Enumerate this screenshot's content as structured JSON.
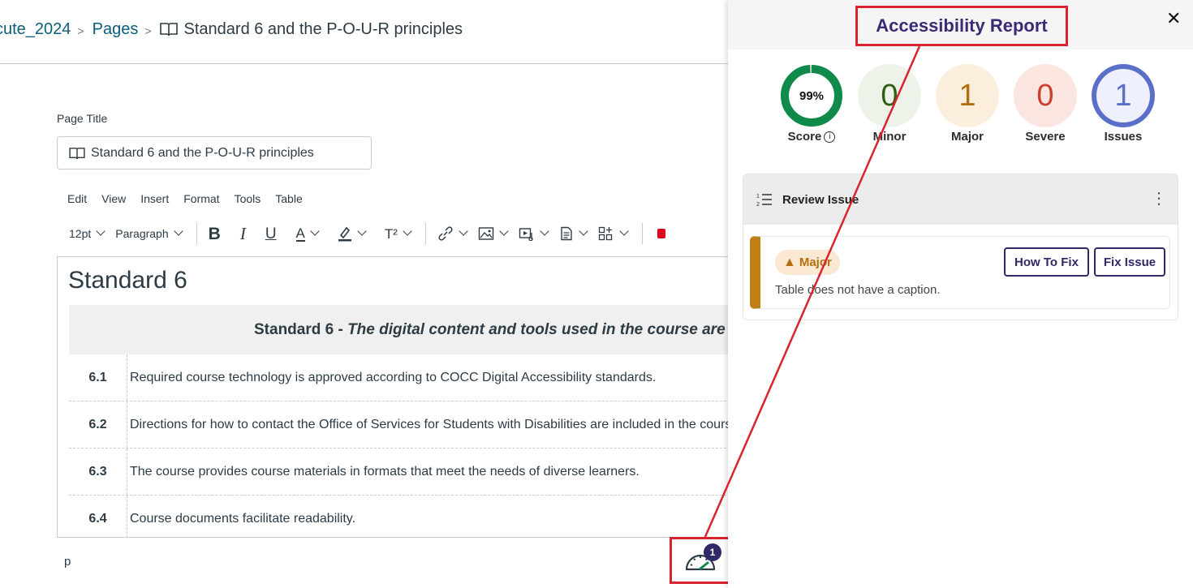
{
  "breadcrumb": {
    "course": "cute_2024",
    "section": "Pages",
    "current": "Standard 6 and the P-O-U-R principles"
  },
  "page_title": {
    "label": "Page Title",
    "value": "Standard 6 and the P-O-U-R principles"
  },
  "menubar": [
    "Edit",
    "View",
    "Insert",
    "Format",
    "Tools",
    "Table"
  ],
  "toolbar": {
    "font_size": "12pt",
    "block_format": "Paragraph",
    "superscript_label": "T²"
  },
  "editor": {
    "heading": "Standard 6",
    "table_header_bold": "Standard 6 - ",
    "table_header_italic": "The digital content and tools used in the course are accessible",
    "rows": [
      {
        "num": "6.1",
        "text": "Required course technology is approved according to COCC Digital Accessibility standards."
      },
      {
        "num": "6.2",
        "text": "Directions for how to contact the Office of Services for Students with Disabilities are included in the course."
      },
      {
        "num": "6.3",
        "text": "The course provides course materials in formats that meet the needs of diverse learners."
      },
      {
        "num": "6.4",
        "text": "Course documents facilitate readability."
      }
    ],
    "status_path": "p"
  },
  "checker": {
    "badge_count": "1",
    "icon": "speedometer-icon"
  },
  "tray": {
    "title": "Accessibility Report",
    "close_glyph": "✕",
    "stats": {
      "score": {
        "value": "99%",
        "label": "Score",
        "percent": 99,
        "color": "#0f8a4a"
      },
      "minor": {
        "value": "0",
        "label": "Minor",
        "color": "#2e5e12",
        "bg": "#eef3ea"
      },
      "major": {
        "value": "1",
        "label": "Major",
        "color": "#b26e0f",
        "bg": "#fbeedd"
      },
      "severe": {
        "value": "0",
        "label": "Severe",
        "color": "#c9412b",
        "bg": "#fbe5e0"
      },
      "issues": {
        "value": "1",
        "label": "Issues",
        "color": "#5a6fc8",
        "bg": "#eef0fb"
      }
    },
    "review": {
      "title": "Review Issue",
      "severity": "Major",
      "message": "Table does not have a caption.",
      "how_to_fix": "How To Fix",
      "fix_issue": "Fix Issue"
    }
  },
  "colors": {
    "annotation_red": "#d9232e",
    "brand_purple": "#2f2a66",
    "link_teal": "#0b5e7a"
  }
}
